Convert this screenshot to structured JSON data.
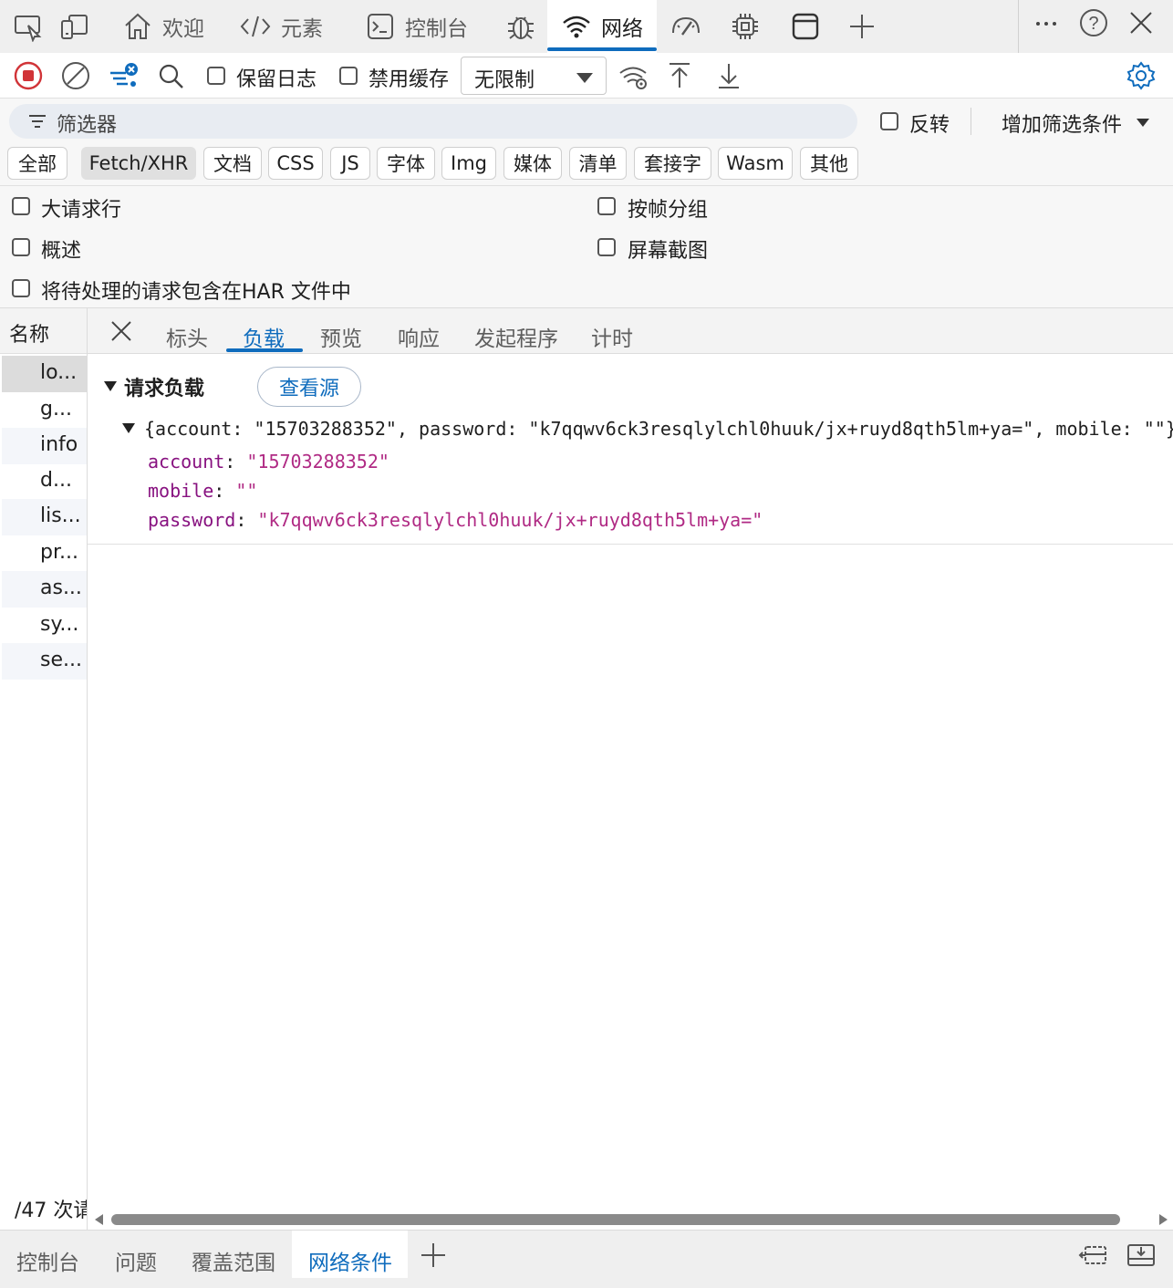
{
  "top_tabs": {
    "inspect": "inspect-element-icon",
    "device": "device-emulation-icon",
    "welcome": "欢迎",
    "elements": "元素",
    "console": "控制台",
    "network": "网络",
    "add": "+"
  },
  "toolbar": {
    "preserve_log": "保留日志",
    "disable_cache": "禁用缓存",
    "throttling": "无限制"
  },
  "filter": {
    "placeholder": "筛选器",
    "invert": "反转",
    "add_filter": "增加筛选条件"
  },
  "type_filters": [
    "全部",
    "Fetch/XHR",
    "文档",
    "CSS",
    "JS",
    "字体",
    "Img",
    "媒体",
    "清单",
    "套接字",
    "Wasm",
    "其他"
  ],
  "active_type_filter": "Fetch/XHR",
  "options": {
    "big_rows": "大请求行",
    "group_by_frame": "按帧分组",
    "overview": "概述",
    "screenshots": "屏幕截图",
    "har_pending": "将待处理的请求包含在HAR 文件中"
  },
  "requests": {
    "header": "名称",
    "items": [
      "lo...",
      "g...",
      "info",
      "d...",
      "lis...",
      "pr...",
      "as...",
      "sy...",
      "se..."
    ],
    "footer": "/47 次请"
  },
  "detail": {
    "tabs": [
      "标头",
      "负载",
      "预览",
      "响应",
      "发起程序",
      "计时"
    ],
    "active_tab": "负载",
    "section_title": "请求负载",
    "view_source": "查看源",
    "summary": "{account: \"15703288352\", password: \"k7qqwv6ck3resqlylchl0huuk/jx+ruyd8qth5lm+ya=\", mobile: \"\"}",
    "fields": [
      {
        "key": "account",
        "value": "\"15703288352\""
      },
      {
        "key": "mobile",
        "value": "\"\""
      },
      {
        "key": "password",
        "value": "\"k7qqwv6ck3resqlylchl0huuk/jx+ruyd8qth5lm+ya=\""
      }
    ]
  },
  "bottom_tabs": {
    "console": "控制台",
    "issues": "问题",
    "coverage": "覆盖范围",
    "network_conditions": "网络条件",
    "add": "+"
  },
  "colors": {
    "accent": "#0f6cbd",
    "record": "#d13438",
    "json_key": "#881280",
    "json_value": "#b02a84"
  }
}
